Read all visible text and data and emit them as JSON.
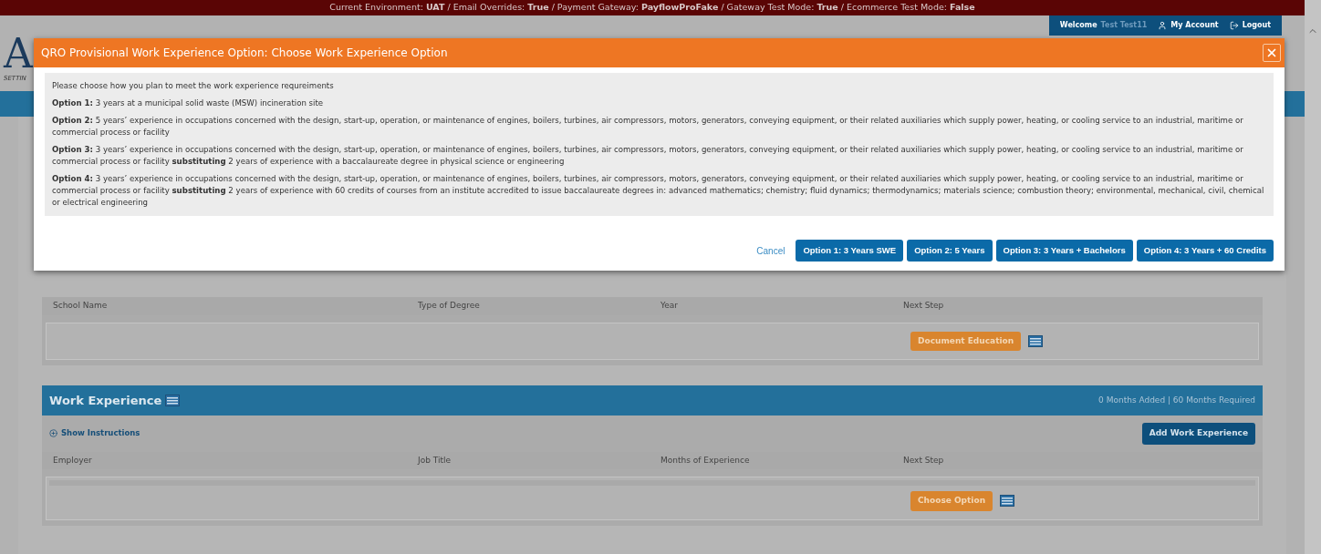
{
  "env_bar": {
    "text": "Current Environment: **UAT** / Email Overrides: **True** / Payment Gateway: **PayflowProFake** / Gateway Test Mode: **True** / Ecommerce Test Mode: **False**"
  },
  "header": {
    "logo": "A",
    "tagline": "SETTIN",
    "welcome_label": "Welcome",
    "user_name": "Test Test11",
    "my_account": "My Account",
    "logout": "Logout"
  },
  "dialog": {
    "title": "QRO Provisional Work Experience Option: Choose Work Experience Option",
    "intro": "Please choose how you plan to meet the work experience requreiments",
    "options": [
      {
        "text": "**Option 1:** 3 years at a municipal solid waste (MSW) incineration site"
      },
      {
        "text": "**Option 2:** 5 years’ experience in occupations concerned with the design, start-up, operation, or maintenance of engines, boilers, turbines, air compressors, motors, generators, conveying equipment, or their related auxiliaries which supply power, heating, or cooling service to an industrial, maritime or commercial process or facility"
      },
      {
        "text": "**Option 3:** 3 years’ experience in occupations concerned with the design, start-up, operation, or maintenance of engines, boilers, turbines, air compressors, motors, generators, conveying equipment, or their related auxiliaries which supply power, heating, or cooling service to an industrial, maritime or commercial process or facility **substituting** 2 years of experience with a baccalaureate degree in physical science or engineering"
      },
      {
        "text": "**Option 4:** 3 years’ experience in occupations concerned with the design, start-up, operation, or maintenance of engines, boilers, turbines, air compressors, motors, generators, conveying equipment, or their related auxiliaries which supply power, heating, or cooling service to an industrial, maritime or commercial process or facility **substituting** 2 years of experience with 60 credits of courses from an institute accredited to issue baccalaureate degrees in:  advanced mathematics; chemistry; fluid dynamics; thermodynamics; materials science; combustion theory; environmental, mechanical, civil, chemical or electrical engineering"
      }
    ],
    "cancel": "Cancel",
    "buttons": [
      "Option 1: 3 Years SWE",
      "Option 2: 5 Years",
      "Option 3: 3 Years + Bachelors",
      "Option 4: 3 Years + 60 Credits"
    ]
  },
  "education": {
    "columns": [
      "School Name",
      "Type of Degree",
      "Year",
      "Next Step"
    ],
    "action": "Document Education"
  },
  "work_experience": {
    "title": "Work Experience",
    "summary": "0 Months Added | 60 Months Required",
    "show_instructions": "Show Instructions",
    "add_button": "Add Work Experience",
    "columns": [
      "Employer",
      "Job Title",
      "Months of Experience",
      "Next Step"
    ],
    "action": "Choose Option"
  }
}
